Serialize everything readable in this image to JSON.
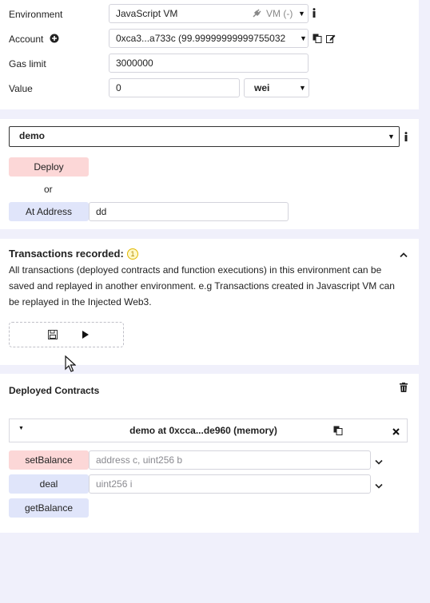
{
  "settings": {
    "environment": {
      "label": "Environment",
      "value": "JavaScript VM",
      "badge": "VM (-)"
    },
    "account": {
      "label": "Account",
      "value": "0xca3...a733c (99.99999999999755032"
    },
    "gas_limit": {
      "label": "Gas limit",
      "value": "3000000"
    },
    "value": {
      "label": "Value",
      "amount": "0",
      "unit": "wei"
    }
  },
  "contract": {
    "selected": "demo",
    "deploy_label": "Deploy",
    "or_label": "or",
    "at_address_label": "At Address",
    "at_address_value": "dd"
  },
  "transactions": {
    "title": "Transactions recorded:",
    "count": "1",
    "description_lines": [
      "All transactions (deployed contracts and function executions) in this environment can be",
      "saved and replayed in another environment. e.g Transactions created in Javascript VM can",
      "be replayed in the Injected Web3."
    ]
  },
  "deployed": {
    "title": "Deployed Contracts",
    "instance": {
      "title": "demo at 0xcca...de960 (memory)",
      "functions": [
        {
          "name": "setBalance",
          "placeholder": "address c, uint256 b",
          "kind": "transact"
        },
        {
          "name": "deal",
          "placeholder": "uint256 i",
          "kind": "call"
        },
        {
          "name": "getBalance",
          "placeholder": "",
          "kind": "call"
        }
      ]
    }
  },
  "colors": {
    "background": "#f0f0fb",
    "transact_button": "#fcd7d7",
    "call_button": "#e0e5fa",
    "badge": "#f0c808"
  }
}
